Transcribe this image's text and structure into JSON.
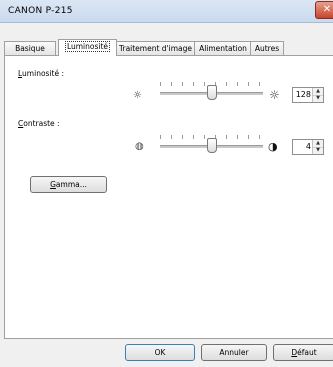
{
  "window": {
    "title": "CANON  P-215",
    "close_glyph": "✕"
  },
  "tabs": [
    {
      "label": "Basique"
    },
    {
      "label": "Luminosité"
    },
    {
      "label": "Traitement d'image"
    },
    {
      "label": "Alimentation"
    },
    {
      "label": "Autres"
    }
  ],
  "brightness": {
    "label_u": "L",
    "label_rest": "uminosité :",
    "value": "128",
    "level_fraction": 0.5,
    "icon_low": "☼",
    "icon_high": "☼"
  },
  "contrast": {
    "label_u": "C",
    "label_rest": "ontraste :",
    "value": "4",
    "level_fraction": 0.5,
    "icon_low": "◍",
    "icon_high": "◑"
  },
  "gamma_button": {
    "label_u": "G",
    "label_rest": "amma..."
  },
  "footer": {
    "ok_label": "OK",
    "cancel_label": "Annuler",
    "default_label_u": "D",
    "default_label_rest": "éfaut"
  },
  "spin_glyphs": {
    "up": "▲",
    "down": "▼"
  }
}
